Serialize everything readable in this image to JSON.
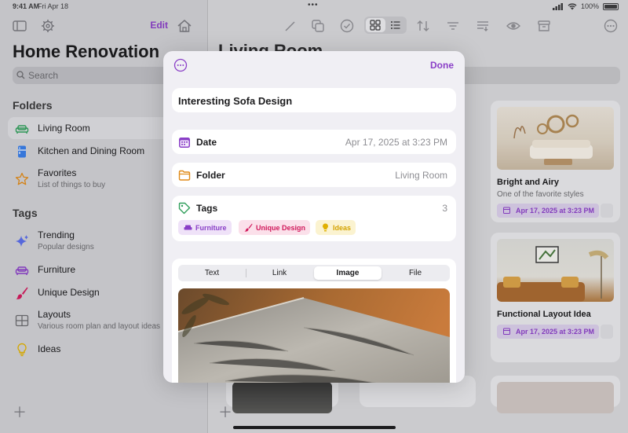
{
  "status_bar": {
    "time": "9:41 AM",
    "date": "Fri Apr 18",
    "battery": "100%"
  },
  "sidebar": {
    "edit_label": "Edit",
    "title": "Home Renovation",
    "search_placeholder": "Search",
    "folders_header": "Folders",
    "folders": [
      {
        "label": "Living Room",
        "selected": true,
        "icon": "sofa-icon"
      },
      {
        "label": "Kitchen and Dining Room",
        "icon": "fridge-icon"
      },
      {
        "label": "Favorites",
        "subtitle": "List of things to buy",
        "icon": "star-icon"
      }
    ],
    "tags_header": "Tags",
    "tags": [
      {
        "label": "Trending",
        "subtitle": "Popular designs",
        "icon": "sparkles-icon"
      },
      {
        "label": "Furniture",
        "icon": "sofa-icon"
      },
      {
        "label": "Unique Design",
        "icon": "paintbrush-icon"
      },
      {
        "label": "Layouts",
        "subtitle": "Various room plan and layout ideas",
        "icon": "layout-grid-icon"
      },
      {
        "label": "Ideas",
        "icon": "lightbulb-icon"
      }
    ]
  },
  "main": {
    "title": "Living Room",
    "cards": [
      {
        "title": "Bright and Airy",
        "subtitle": "One of the favorite styles",
        "date": "Apr 17, 2025 at 3:23 PM"
      },
      {
        "title": "Functional Layout Idea",
        "date": "Apr 17, 2025 at 3:23 PM"
      }
    ]
  },
  "modal": {
    "done_label": "Done",
    "note_title": "Interesting Sofa Design",
    "date_label": "Date",
    "date_value": "Apr 17, 2025 at 3:23 PM",
    "folder_label": "Folder",
    "folder_value": "Living Room",
    "tags_label": "Tags",
    "tags_count": "3",
    "tag_pills": [
      {
        "label": "Furniture",
        "color": "#8a3fc7",
        "bg": "#efe2f8",
        "icon": "sofa-icon"
      },
      {
        "label": "Unique Design",
        "color": "#d11a5c",
        "bg": "#fbe0ea",
        "icon": "paintbrush-icon"
      },
      {
        "label": "Ideas",
        "color": "#d4a300",
        "bg": "#fbf3d0",
        "icon": "lightbulb-icon"
      }
    ],
    "content_tabs": [
      "Text",
      "Link",
      "Image",
      "File"
    ],
    "active_tab": "Image"
  },
  "colors": {
    "accent": "#8a3fc7",
    "tag_pink": "#d11a5c",
    "tag_yellow": "#d4a300"
  }
}
